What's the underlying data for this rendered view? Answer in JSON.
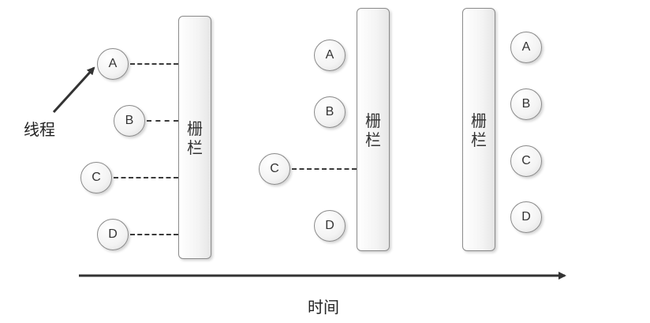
{
  "barriers": [
    {
      "label_top": "栅",
      "label_bottom": "栏"
    },
    {
      "label_top": "栅",
      "label_bottom": "栏"
    },
    {
      "label_top": "栅",
      "label_bottom": "栏"
    }
  ],
  "stage1_threads": [
    "A",
    "B",
    "C",
    "D"
  ],
  "stage2_threads": [
    "A",
    "B",
    "C",
    "D"
  ],
  "stage3_threads": [
    "A",
    "B",
    "C",
    "D"
  ],
  "labels": {
    "thread_caption": "线程",
    "time_caption": "时间"
  },
  "colors": {
    "line": "#333333",
    "border": "#8a8a8a"
  }
}
